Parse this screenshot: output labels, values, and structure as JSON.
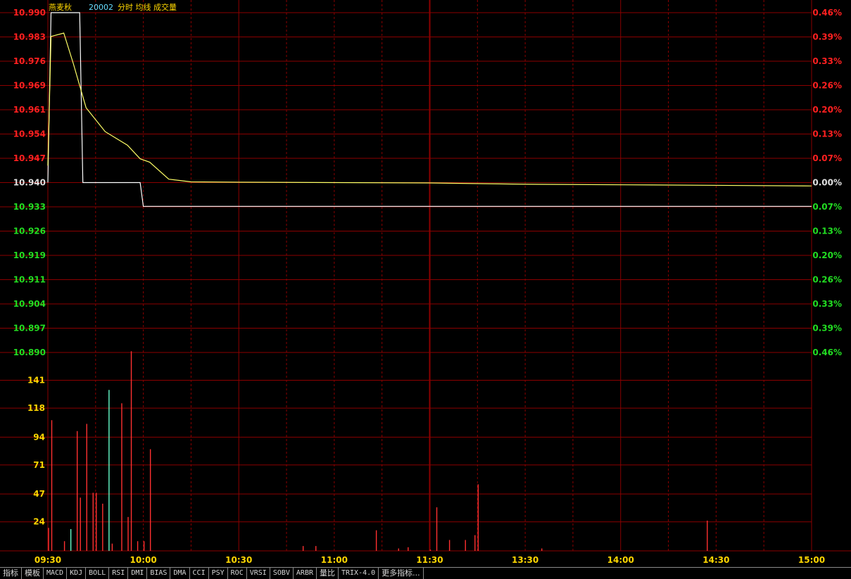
{
  "header": {
    "stock_name": "燕麦秋",
    "code": "20002",
    "labels": "分时 均线 成交量"
  },
  "colors": {
    "background": "#000000",
    "grid": "#8b0000",
    "price_up": "#ff2020",
    "price_down": "#22dd22",
    "neutral": "#e0e0e0",
    "price_line": "#ffffff",
    "avg_line": "#ffff66",
    "volume_labels": "#ffd700",
    "time_labels": "#ffd700",
    "volume_up": "#ff3030",
    "volume_down": "#66ffcc"
  },
  "tabs": [
    "指标",
    "模板",
    "MACD",
    "KDJ",
    "BOLL",
    "RSI",
    "DMI",
    "BIAS",
    "DMA",
    "CCI",
    "PSY",
    "ROC",
    "VRSI",
    "SOBV",
    "ARBR",
    "量比",
    "TRIX-4.0",
    "更多指标..."
  ],
  "chart_data": {
    "type": "line",
    "session": "intraday",
    "x_ticks": [
      "09:30",
      "10:00",
      "10:30",
      "11:00",
      "11:30",
      "13:30",
      "14:00",
      "14:30",
      "15:00"
    ],
    "price_axis": {
      "ticks": [
        "10.990",
        "10.983",
        "10.976",
        "10.969",
        "10.961",
        "10.954",
        "10.947",
        "10.940",
        "10.933",
        "10.926",
        "10.919",
        "10.911",
        "10.904",
        "10.897",
        "10.890"
      ],
      "reference": 10.94,
      "ylim": [
        10.89,
        10.99
      ]
    },
    "pct_axis": {
      "ticks": [
        "0.46%",
        "0.39%",
        "0.33%",
        "0.26%",
        "0.20%",
        "0.13%",
        "0.07%",
        "0.00%",
        "0.07%",
        "0.13%",
        "0.20%",
        "0.26%",
        "0.33%",
        "0.39%",
        "0.46%"
      ]
    },
    "volume_axis": {
      "ticks": [
        "141",
        "118",
        "94",
        "71",
        "47",
        "24"
      ],
      "ylim": [
        0,
        164
      ]
    },
    "series": [
      {
        "role": "price",
        "points": [
          [
            0,
            10.94
          ],
          [
            1,
            10.99
          ],
          [
            10,
            10.99
          ],
          [
            11,
            10.94
          ],
          [
            29,
            10.94
          ],
          [
            30,
            10.933
          ],
          [
            31,
            10.933
          ],
          [
            240,
            10.933
          ]
        ]
      },
      {
        "role": "average",
        "points": [
          [
            0,
            10.945
          ],
          [
            1,
            10.983
          ],
          [
            5,
            10.984
          ],
          [
            8,
            10.975
          ],
          [
            12,
            10.962
          ],
          [
            18,
            10.955
          ],
          [
            25,
            10.951
          ],
          [
            29,
            10.947
          ],
          [
            32,
            10.946
          ],
          [
            38,
            10.941
          ],
          [
            45,
            10.9402
          ],
          [
            60,
            10.9401
          ],
          [
            120,
            10.9399
          ],
          [
            150,
            10.9395
          ],
          [
            190,
            10.9393
          ],
          [
            240,
            10.939
          ]
        ]
      }
    ],
    "volume": [
      {
        "x": 0,
        "v": 19,
        "color": "up"
      },
      {
        "x": 1,
        "v": 108,
        "color": "up"
      },
      {
        "x": 5,
        "v": 8,
        "color": "up"
      },
      {
        "x": 7,
        "v": 18,
        "color": "down"
      },
      {
        "x": 9,
        "v": 99,
        "color": "up"
      },
      {
        "x": 10,
        "v": 44,
        "color": "up"
      },
      {
        "x": 12,
        "v": 105,
        "color": "up"
      },
      {
        "x": 14,
        "v": 48,
        "color": "up"
      },
      {
        "x": 15,
        "v": 48,
        "color": "up"
      },
      {
        "x": 17,
        "v": 39,
        "color": "up"
      },
      {
        "x": 19,
        "v": 133,
        "color": "down"
      },
      {
        "x": 20,
        "v": 6,
        "color": "up"
      },
      {
        "x": 23,
        "v": 122,
        "color": "up"
      },
      {
        "x": 25,
        "v": 28,
        "color": "up"
      },
      {
        "x": 26,
        "v": 165,
        "color": "up"
      },
      {
        "x": 28,
        "v": 8,
        "color": "up"
      },
      {
        "x": 30,
        "v": 8,
        "color": "up"
      },
      {
        "x": 32,
        "v": 84,
        "color": "up"
      },
      {
        "x": 80,
        "v": 4,
        "color": "up"
      },
      {
        "x": 84,
        "v": 4,
        "color": "up"
      },
      {
        "x": 103,
        "v": 17,
        "color": "up"
      },
      {
        "x": 110,
        "v": 2,
        "color": "up"
      },
      {
        "x": 113,
        "v": 3,
        "color": "up"
      },
      {
        "x": 120,
        "v": 1,
        "color": "up"
      },
      {
        "x": 122,
        "v": 36,
        "color": "up"
      },
      {
        "x": 126,
        "v": 9,
        "color": "up"
      },
      {
        "x": 131,
        "v": 9,
        "color": "up"
      },
      {
        "x": 134,
        "v": 13,
        "color": "up"
      },
      {
        "x": 135,
        "v": 55,
        "color": "up"
      },
      {
        "x": 155,
        "v": 2,
        "color": "up"
      },
      {
        "x": 207,
        "v": 25,
        "color": "up"
      }
    ]
  }
}
